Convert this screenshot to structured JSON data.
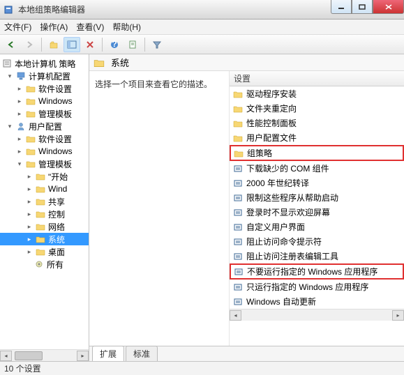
{
  "window": {
    "title": "本地组策略编辑器"
  },
  "menubar": {
    "file": "文件(F)",
    "action": "操作(A)",
    "view": "查看(V)",
    "help": "帮助(H)"
  },
  "tree": {
    "root": "本地计算机 策略",
    "computer_config": "计算机配置",
    "software_settings": "软件设置",
    "windows_settings": "Windows",
    "admin_templates": "管理模板",
    "user_config": "用户配置",
    "user_software": "软件设置",
    "user_windows": "Windows",
    "user_admin": "管理模板",
    "start_menu": "\"开始",
    "wind": "Wind",
    "share": "共享",
    "control": "控制",
    "network": "网络",
    "system": "系统",
    "desktop": "桌面",
    "all_settings": "所有"
  },
  "right": {
    "header_title": "系统",
    "desc_prompt": "选择一个项目来查看它的描述。",
    "settings_header": "设置",
    "items": {
      "driver_install": "驱动程序安装",
      "folder_redirect": "文件夹重定向",
      "perf_panel": "性能控制面板",
      "user_profile": "用户配置文件",
      "group_policy": "组策略",
      "download_com": "下载缺少的 COM 组件",
      "y2k": "2000 年世纪转译",
      "limit_boot": "限制这些程序从帮助启动",
      "no_welcome": "登录时不显示欢迎屏幕",
      "custom_ui": "自定义用户界面",
      "block_cmd": "阻止访问命令提示符",
      "block_regedit": "阻止访问注册表编辑工具",
      "dont_run": "不要运行指定的 Windows 应用程序",
      "only_run": "只运行指定的 Windows 应用程序",
      "win_update": "Windows 自动更新"
    }
  },
  "tabs": {
    "extended": "扩展",
    "standard": "标准"
  },
  "statusbar": {
    "text": "10 个设置"
  }
}
